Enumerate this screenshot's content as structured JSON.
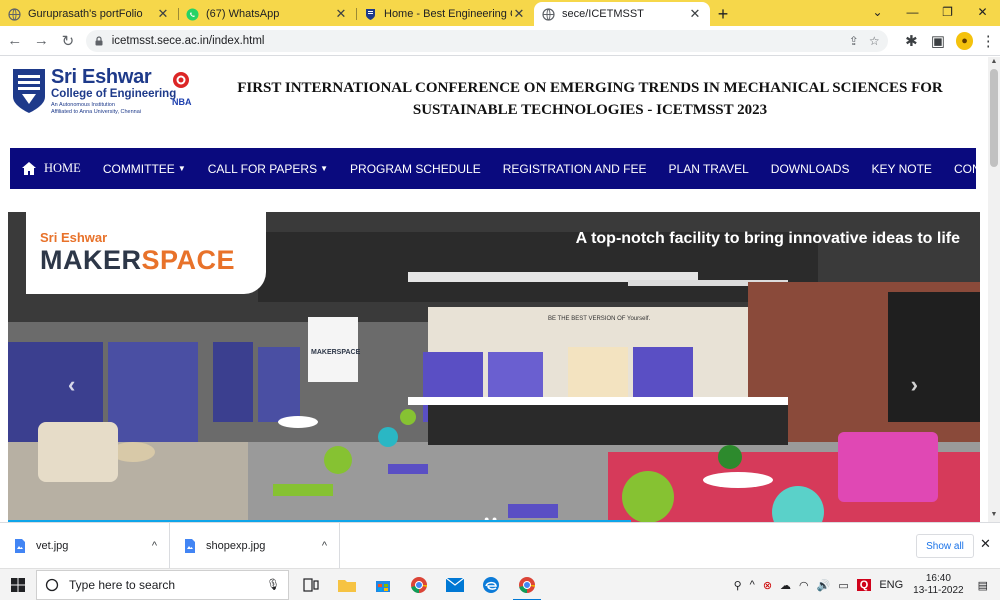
{
  "browser": {
    "tabs": [
      {
        "title": "Guruprasath's portFolio",
        "active": false
      },
      {
        "title": "(67) WhatsApp",
        "active": false
      },
      {
        "title": "Home - Best Engineering College",
        "active": false
      },
      {
        "title": "sece/ICETMSST",
        "active": true
      }
    ],
    "new_tab_label": "+",
    "url": "icetmsst.sece.ac.in/index.html"
  },
  "page": {
    "logo": {
      "name": "Sri Eshwar",
      "subtitle": "College of Engineering",
      "tag1": "An Autonomous Institution",
      "tag2": "Affiliated to Anna University, Chennai",
      "badge": "NBA"
    },
    "title_line1": "FIRST INTERNATIONAL CONFERENCE ON EMERGING TRENDS IN MECHANICAL SCIENCES FOR",
    "title_line2": "SUSTAINABLE TECHNOLOGIES - ICETMSST 2023",
    "nav": {
      "home": "HOME",
      "committee": "COMMITTEE",
      "call_for_papers": "CALL FOR PAPERS",
      "program_schedule": "PROGRAM SCHEDULE",
      "registration": "REGISTRATION AND FEE",
      "plan_travel": "PLAN TRAVEL",
      "downloads": "DOWNLOADS",
      "key_note": "KEY NOTE",
      "contact_us": "CONTACT US"
    },
    "hero": {
      "brand_small": "Sri Eshwar",
      "brand_large_a": "MAKER",
      "brand_large_b": "SPACE",
      "tagline": "A top-notch facility to bring innovative ideas to life",
      "screen_text": "MAKERSPACE",
      "wall_text": "BE THE BEST VERSION OF Yourself."
    }
  },
  "downloads": {
    "items": [
      {
        "name": "vet.jpg"
      },
      {
        "name": "shopexp.jpg"
      }
    ],
    "show_all": "Show all"
  },
  "taskbar": {
    "search_placeholder": "Type here to search",
    "lang": "ENG",
    "time": "16:40",
    "date": "13-11-2022"
  },
  "colors": {
    "tab_strip": "#f6d74a",
    "nav": "#0a0a7e",
    "brand_orange": "#e8722a"
  }
}
